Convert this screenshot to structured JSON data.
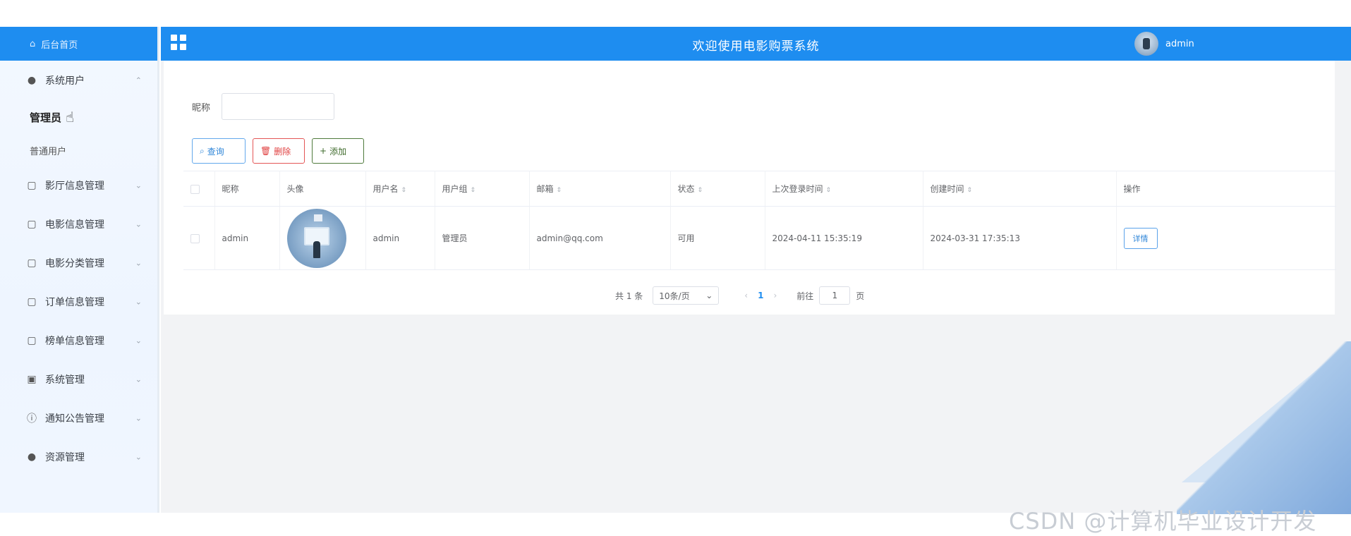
{
  "sidebar": {
    "brand_label": "后台首页",
    "items": [
      {
        "label": "系统用户",
        "icon": "user-icon",
        "expanded": true
      },
      {
        "label": "影厅信息管理",
        "icon": "folder-icon"
      },
      {
        "label": "电影信息管理",
        "icon": "folder-icon"
      },
      {
        "label": "电影分类管理",
        "icon": "folder-icon"
      },
      {
        "label": "订单信息管理",
        "icon": "folder-icon"
      },
      {
        "label": "榜单信息管理",
        "icon": "folder-icon"
      },
      {
        "label": "系统管理",
        "icon": "image-icon"
      },
      {
        "label": "通知公告管理",
        "icon": "info-icon"
      },
      {
        "label": "资源管理",
        "icon": "pin-icon"
      }
    ],
    "sub_items": [
      {
        "label": "管理员",
        "active": true
      },
      {
        "label": "普通用户",
        "active": false
      }
    ]
  },
  "header": {
    "title": "欢迎使用电影购票系统",
    "username": "admin"
  },
  "search": {
    "label": "昵称",
    "placeholder": ""
  },
  "toolbar": {
    "query_label": "查询",
    "delete_label": "删除",
    "add_label": "添加"
  },
  "table": {
    "columns": [
      "昵称",
      "头像",
      "用户名",
      "用户组",
      "邮箱",
      "状态",
      "上次登录时间",
      "创建时间",
      "操作"
    ],
    "rows": [
      {
        "nickname": "admin",
        "username": "admin",
        "group": "管理员",
        "email": "admin@qq.com",
        "status": "可用",
        "last_login": "2024-04-11 15:35:19",
        "created": "2024-03-31 17:35:13",
        "action": "详情"
      }
    ]
  },
  "pagination": {
    "total": "共 1 条",
    "page_size": "10条/页",
    "current_page": "1",
    "goto_label": "前往",
    "goto_value": "1",
    "page_suffix": "页"
  },
  "watermark": "CSDN @计算机毕业设计开发",
  "colors": {
    "accent": "#1e8df0",
    "danger": "#e04141",
    "success": "#3f6b2c"
  }
}
